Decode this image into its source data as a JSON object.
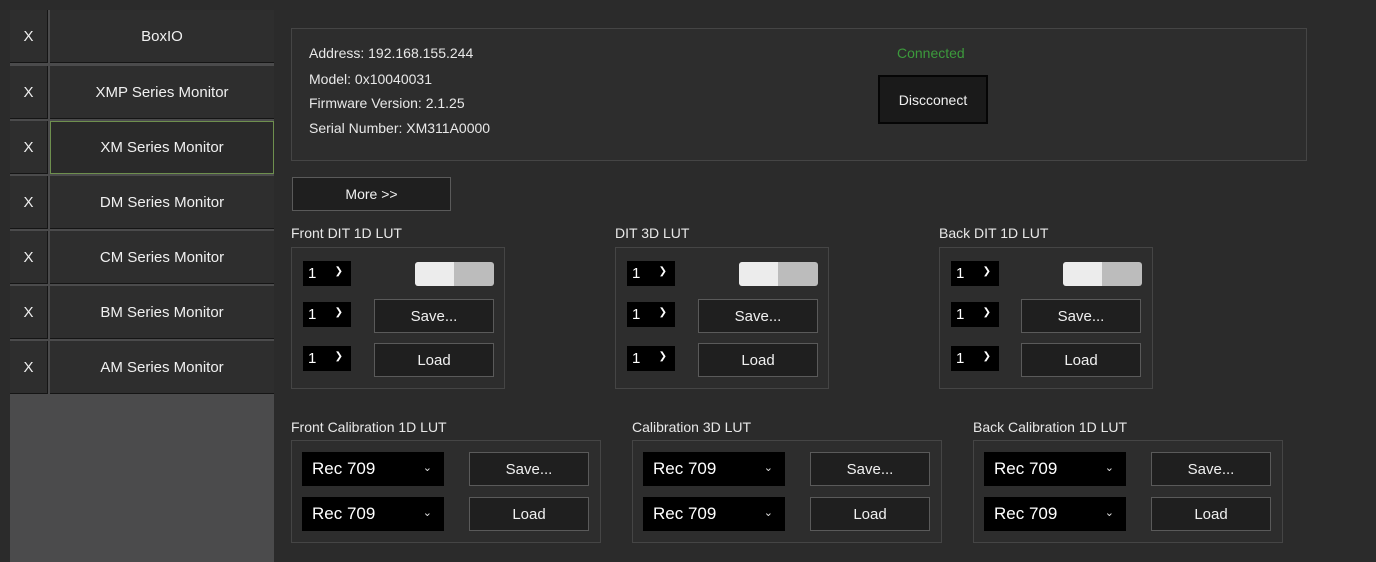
{
  "sidebar": {
    "items": [
      {
        "close": "X",
        "label": "BoxIO"
      },
      {
        "close": "X",
        "label": "XMP Series Monitor"
      },
      {
        "close": "X",
        "label": "XM Series Monitor"
      },
      {
        "close": "X",
        "label": "DM Series Monitor"
      },
      {
        "close": "X",
        "label": "CM Series Monitor"
      },
      {
        "close": "X",
        "label": "BM Series Monitor"
      },
      {
        "close": "X",
        "label": "AM Series Monitor"
      }
    ],
    "active_index": 2
  },
  "device": {
    "address": "Address: 192.168.155.244",
    "model": "Model: 0x10040031",
    "firmware": "Firmware Version: 2.1.25",
    "serial": "Serial Number: XM311A0000",
    "status": "Connected",
    "disconnect_label": "Discconect"
  },
  "more_label": "More >>",
  "lut_groups": [
    {
      "title": "Front DIT 1D LUT",
      "selects": [
        "1",
        "1",
        "1"
      ],
      "save": "Save...",
      "load": "Load",
      "toggle_on": false
    },
    {
      "title": "DIT 3D LUT",
      "selects": [
        "1",
        "1",
        "1"
      ],
      "save": "Save...",
      "load": "Load",
      "toggle_on": false
    },
    {
      "title": "Back DIT 1D LUT",
      "selects": [
        "1",
        "1",
        "1"
      ],
      "save": "Save...",
      "load": "Load",
      "toggle_on": false
    }
  ],
  "calibration_groups": [
    {
      "title": "Front Calibration 1D LUT",
      "selects": [
        "Rec 709",
        "Rec 709"
      ],
      "save": "Save...",
      "load": "Load"
    },
    {
      "title": "Calibration 3D LUT",
      "selects": [
        "Rec 709",
        "Rec 709"
      ],
      "save": "Save...",
      "load": "Load"
    },
    {
      "title": "Back Calibration 1D LUT",
      "selects": [
        "Rec 709",
        "Rec 709"
      ],
      "save": "Save...",
      "load": "Load"
    }
  ],
  "colors": {
    "status": "#3c9a3c",
    "active_border": "#6e8f4e"
  }
}
